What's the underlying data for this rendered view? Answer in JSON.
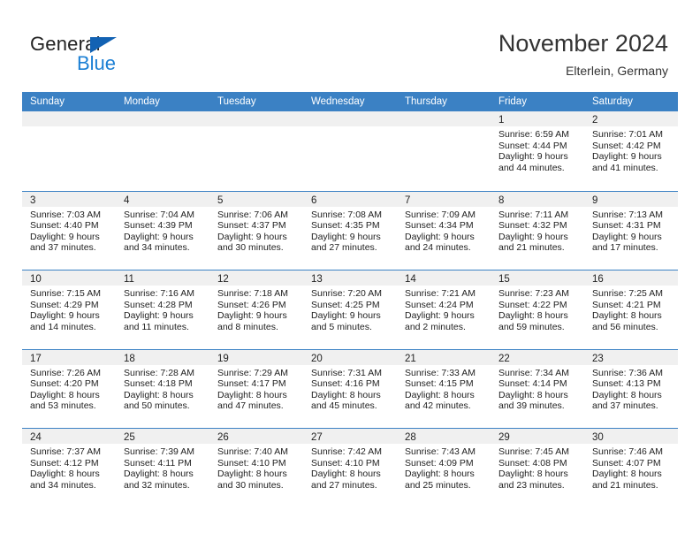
{
  "brand": {
    "word_one": "General",
    "word_two": "Blue",
    "triangle_icon": "triangle-icon",
    "accent_blue": "#1b7fd4",
    "logo_triangle_blue": "#1262b3"
  },
  "header": {
    "title": "November 2024",
    "subtitle": "Elterlein, Germany"
  },
  "calendar": {
    "header_background": "#3b81c4",
    "day_strip_background": "#f0f0f0",
    "weekdays": [
      "Sunday",
      "Monday",
      "Tuesday",
      "Wednesday",
      "Thursday",
      "Friday",
      "Saturday"
    ],
    "weeks": [
      [
        {
          "empty": true
        },
        {
          "empty": true
        },
        {
          "empty": true
        },
        {
          "empty": true
        },
        {
          "empty": true
        },
        {
          "day": "1",
          "sunrise": "Sunrise: 6:59 AM",
          "sunset": "Sunset: 4:44 PM",
          "daylight_line1": "Daylight: 9 hours",
          "daylight_line2": "and 44 minutes."
        },
        {
          "day": "2",
          "sunrise": "Sunrise: 7:01 AM",
          "sunset": "Sunset: 4:42 PM",
          "daylight_line1": "Daylight: 9 hours",
          "daylight_line2": "and 41 minutes."
        }
      ],
      [
        {
          "day": "3",
          "sunrise": "Sunrise: 7:03 AM",
          "sunset": "Sunset: 4:40 PM",
          "daylight_line1": "Daylight: 9 hours",
          "daylight_line2": "and 37 minutes."
        },
        {
          "day": "4",
          "sunrise": "Sunrise: 7:04 AM",
          "sunset": "Sunset: 4:39 PM",
          "daylight_line1": "Daylight: 9 hours",
          "daylight_line2": "and 34 minutes."
        },
        {
          "day": "5",
          "sunrise": "Sunrise: 7:06 AM",
          "sunset": "Sunset: 4:37 PM",
          "daylight_line1": "Daylight: 9 hours",
          "daylight_line2": "and 30 minutes."
        },
        {
          "day": "6",
          "sunrise": "Sunrise: 7:08 AM",
          "sunset": "Sunset: 4:35 PM",
          "daylight_line1": "Daylight: 9 hours",
          "daylight_line2": "and 27 minutes."
        },
        {
          "day": "7",
          "sunrise": "Sunrise: 7:09 AM",
          "sunset": "Sunset: 4:34 PM",
          "daylight_line1": "Daylight: 9 hours",
          "daylight_line2": "and 24 minutes."
        },
        {
          "day": "8",
          "sunrise": "Sunrise: 7:11 AM",
          "sunset": "Sunset: 4:32 PM",
          "daylight_line1": "Daylight: 9 hours",
          "daylight_line2": "and 21 minutes."
        },
        {
          "day": "9",
          "sunrise": "Sunrise: 7:13 AM",
          "sunset": "Sunset: 4:31 PM",
          "daylight_line1": "Daylight: 9 hours",
          "daylight_line2": "and 17 minutes."
        }
      ],
      [
        {
          "day": "10",
          "sunrise": "Sunrise: 7:15 AM",
          "sunset": "Sunset: 4:29 PM",
          "daylight_line1": "Daylight: 9 hours",
          "daylight_line2": "and 14 minutes."
        },
        {
          "day": "11",
          "sunrise": "Sunrise: 7:16 AM",
          "sunset": "Sunset: 4:28 PM",
          "daylight_line1": "Daylight: 9 hours",
          "daylight_line2": "and 11 minutes."
        },
        {
          "day": "12",
          "sunrise": "Sunrise: 7:18 AM",
          "sunset": "Sunset: 4:26 PM",
          "daylight_line1": "Daylight: 9 hours",
          "daylight_line2": "and 8 minutes."
        },
        {
          "day": "13",
          "sunrise": "Sunrise: 7:20 AM",
          "sunset": "Sunset: 4:25 PM",
          "daylight_line1": "Daylight: 9 hours",
          "daylight_line2": "and 5 minutes."
        },
        {
          "day": "14",
          "sunrise": "Sunrise: 7:21 AM",
          "sunset": "Sunset: 4:24 PM",
          "daylight_line1": "Daylight: 9 hours",
          "daylight_line2": "and 2 minutes."
        },
        {
          "day": "15",
          "sunrise": "Sunrise: 7:23 AM",
          "sunset": "Sunset: 4:22 PM",
          "daylight_line1": "Daylight: 8 hours",
          "daylight_line2": "and 59 minutes."
        },
        {
          "day": "16",
          "sunrise": "Sunrise: 7:25 AM",
          "sunset": "Sunset: 4:21 PM",
          "daylight_line1": "Daylight: 8 hours",
          "daylight_line2": "and 56 minutes."
        }
      ],
      [
        {
          "day": "17",
          "sunrise": "Sunrise: 7:26 AM",
          "sunset": "Sunset: 4:20 PM",
          "daylight_line1": "Daylight: 8 hours",
          "daylight_line2": "and 53 minutes."
        },
        {
          "day": "18",
          "sunrise": "Sunrise: 7:28 AM",
          "sunset": "Sunset: 4:18 PM",
          "daylight_line1": "Daylight: 8 hours",
          "daylight_line2": "and 50 minutes."
        },
        {
          "day": "19",
          "sunrise": "Sunrise: 7:29 AM",
          "sunset": "Sunset: 4:17 PM",
          "daylight_line1": "Daylight: 8 hours",
          "daylight_line2": "and 47 minutes."
        },
        {
          "day": "20",
          "sunrise": "Sunrise: 7:31 AM",
          "sunset": "Sunset: 4:16 PM",
          "daylight_line1": "Daylight: 8 hours",
          "daylight_line2": "and 45 minutes."
        },
        {
          "day": "21",
          "sunrise": "Sunrise: 7:33 AM",
          "sunset": "Sunset: 4:15 PM",
          "daylight_line1": "Daylight: 8 hours",
          "daylight_line2": "and 42 minutes."
        },
        {
          "day": "22",
          "sunrise": "Sunrise: 7:34 AM",
          "sunset": "Sunset: 4:14 PM",
          "daylight_line1": "Daylight: 8 hours",
          "daylight_line2": "and 39 minutes."
        },
        {
          "day": "23",
          "sunrise": "Sunrise: 7:36 AM",
          "sunset": "Sunset: 4:13 PM",
          "daylight_line1": "Daylight: 8 hours",
          "daylight_line2": "and 37 minutes."
        }
      ],
      [
        {
          "day": "24",
          "sunrise": "Sunrise: 7:37 AM",
          "sunset": "Sunset: 4:12 PM",
          "daylight_line1": "Daylight: 8 hours",
          "daylight_line2": "and 34 minutes."
        },
        {
          "day": "25",
          "sunrise": "Sunrise: 7:39 AM",
          "sunset": "Sunset: 4:11 PM",
          "daylight_line1": "Daylight: 8 hours",
          "daylight_line2": "and 32 minutes."
        },
        {
          "day": "26",
          "sunrise": "Sunrise: 7:40 AM",
          "sunset": "Sunset: 4:10 PM",
          "daylight_line1": "Daylight: 8 hours",
          "daylight_line2": "and 30 minutes."
        },
        {
          "day": "27",
          "sunrise": "Sunrise: 7:42 AM",
          "sunset": "Sunset: 4:10 PM",
          "daylight_line1": "Daylight: 8 hours",
          "daylight_line2": "and 27 minutes."
        },
        {
          "day": "28",
          "sunrise": "Sunrise: 7:43 AM",
          "sunset": "Sunset: 4:09 PM",
          "daylight_line1": "Daylight: 8 hours",
          "daylight_line2": "and 25 minutes."
        },
        {
          "day": "29",
          "sunrise": "Sunrise: 7:45 AM",
          "sunset": "Sunset: 4:08 PM",
          "daylight_line1": "Daylight: 8 hours",
          "daylight_line2": "and 23 minutes."
        },
        {
          "day": "30",
          "sunrise": "Sunrise: 7:46 AM",
          "sunset": "Sunset: 4:07 PM",
          "daylight_line1": "Daylight: 8 hours",
          "daylight_line2": "and 21 minutes."
        }
      ]
    ]
  }
}
